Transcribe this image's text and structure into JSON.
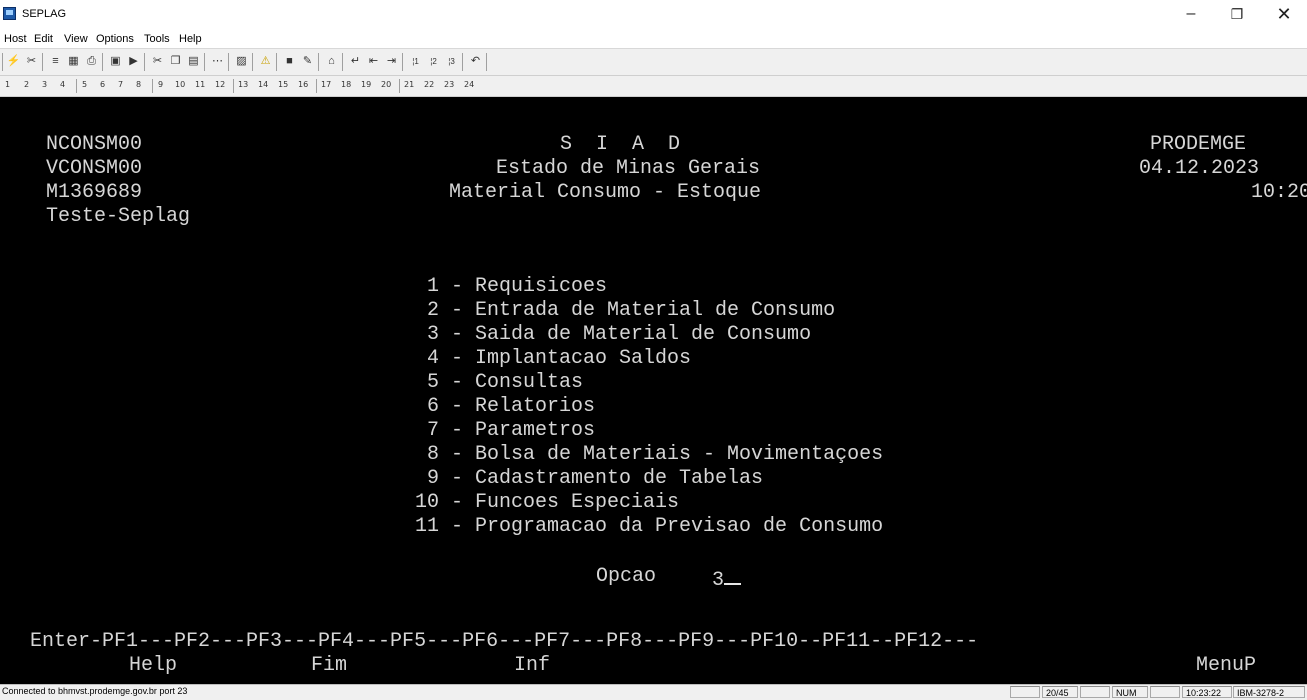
{
  "window": {
    "title": "SEPLAG",
    "minimize": "–",
    "maximize": "❐",
    "close": "✕"
  },
  "menu": [
    "Host",
    "Edit",
    "View",
    "Options",
    "Tools",
    "Help"
  ],
  "toolbar_pf_keys": [
    "1",
    "2",
    "3",
    "4",
    "5",
    "6",
    "7",
    "8",
    "9",
    "10",
    "11",
    "12",
    "13",
    "14",
    "15",
    "16",
    "17",
    "18",
    "19",
    "20",
    "21",
    "22",
    "23",
    "24"
  ],
  "terminal": {
    "header_left": [
      "NCONSM00",
      "VCONSM00",
      "M1369689",
      "Teste-Seplag"
    ],
    "header_center": [
      "S  I  A  D",
      "Estado de Minas Gerais",
      "Material Consumo - Estoque"
    ],
    "header_right": [
      "PRODEMGE",
      "04.12.2023",
      "10:20"
    ],
    "menu_options": [
      " 1 - Requisicoes",
      " 2 - Entrada de Material de Consumo",
      " 3 - Saida de Material de Consumo",
      " 4 - Implantacao Saldos",
      " 5 - Consultas",
      " 6 - Relatorios",
      " 7 - Parametros",
      " 8 - Bolsa de Materiais - Movimentaçoes",
      " 9 - Cadastramento de Tabelas",
      "10 - Funcoes Especiais",
      "11 - Programacao da Previsao de Consumo"
    ],
    "option_label": "Opcao",
    "option_value": "3",
    "pf_line": "Enter-PF1---PF2---PF3---PF4---PF5---PF6---PF7---PF8---PF9---PF10--PF11--PF12---",
    "pf_help_labels": {
      "pf1": "Help",
      "pf3": "Fim",
      "pf5": "Inf",
      "pf12": "MenuP"
    }
  },
  "status": {
    "connection": "Connected to bhmvst.prodemge.gov.br port 23",
    "cursor_pos": "20/45",
    "num": "NUM",
    "time": "10:23:22",
    "model": "IBM-3278-2"
  }
}
